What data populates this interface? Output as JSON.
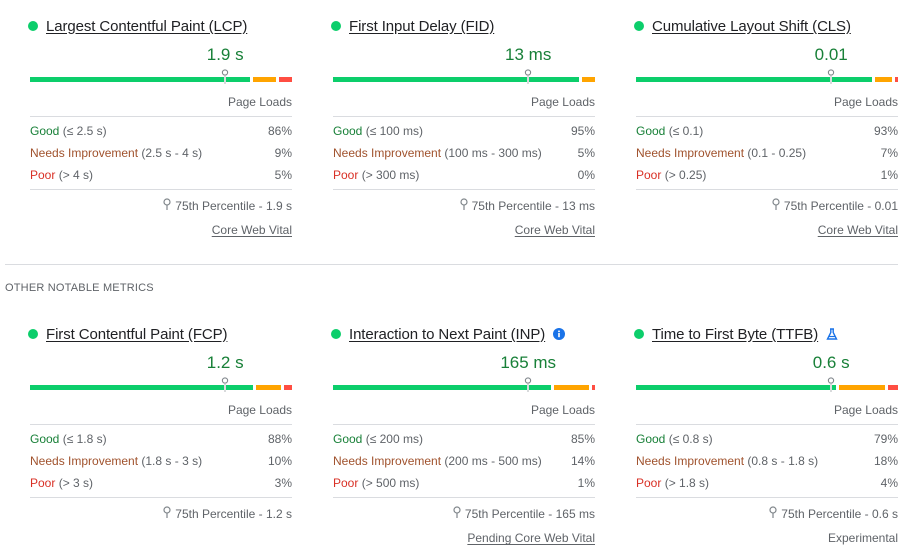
{
  "colors": {
    "good": "#0cce6b",
    "needs_improvement": "#ffa400",
    "poor": "#ff4e42",
    "value_text": "#188038",
    "info_icon": "#1a73e8"
  },
  "section_heading": "OTHER NOTABLE METRICS",
  "core_metrics": [
    {
      "title": "Largest Contentful Paint (LCP)",
      "value": "1.9 s",
      "marker_position": 0.745,
      "page_loads_label": "Page Loads",
      "distribution": [
        {
          "label": "Good",
          "range": "(≤ 2.5 s)",
          "percent": "86%",
          "fraction": 0.86
        },
        {
          "label": "Needs Improvement",
          "range": "(2.5 s - 4 s)",
          "percent": "9%",
          "fraction": 0.09
        },
        {
          "label": "Poor",
          "range": "(> 4 s)",
          "percent": "5%",
          "fraction": 0.05
        }
      ],
      "percentile_label": "75th Percentile - 1.9 s",
      "footer_label": "Core Web Vital",
      "footer_is_link": true,
      "extra_icon": null
    },
    {
      "title": "First Input Delay (FID)",
      "value": "13 ms",
      "marker_position": 0.745,
      "page_loads_label": "Page Loads",
      "distribution": [
        {
          "label": "Good",
          "range": "(≤ 100 ms)",
          "percent": "95%",
          "fraction": 0.95
        },
        {
          "label": "Needs Improvement",
          "range": "(100 ms - 300 ms)",
          "percent": "5%",
          "fraction": 0.05
        },
        {
          "label": "Poor",
          "range": "(> 300 ms)",
          "percent": "0%",
          "fraction": 0.0
        }
      ],
      "percentile_label": "75th Percentile - 13 ms",
      "footer_label": "Core Web Vital",
      "footer_is_link": true,
      "extra_icon": null
    },
    {
      "title": "Cumulative Layout Shift (CLS)",
      "value": "0.01",
      "marker_position": 0.745,
      "page_loads_label": "Page Loads",
      "distribution": [
        {
          "label": "Good",
          "range": "(≤ 0.1)",
          "percent": "93%",
          "fraction": 0.93
        },
        {
          "label": "Needs Improvement",
          "range": "(0.1 - 0.25)",
          "percent": "7%",
          "fraction": 0.07
        },
        {
          "label": "Poor",
          "range": "(> 0.25)",
          "percent": "1%",
          "fraction": 0.01
        }
      ],
      "percentile_label": "75th Percentile - 0.01",
      "footer_label": "Core Web Vital",
      "footer_is_link": true,
      "extra_icon": null
    }
  ],
  "other_metrics": [
    {
      "title": "First Contentful Paint (FCP)",
      "value": "1.2 s",
      "marker_position": 0.745,
      "page_loads_label": "Page Loads",
      "distribution": [
        {
          "label": "Good",
          "range": "(≤ 1.8 s)",
          "percent": "88%",
          "fraction": 0.88
        },
        {
          "label": "Needs Improvement",
          "range": "(1.8 s - 3 s)",
          "percent": "10%",
          "fraction": 0.1
        },
        {
          "label": "Poor",
          "range": "(> 3 s)",
          "percent": "3%",
          "fraction": 0.03
        }
      ],
      "percentile_label": "75th Percentile - 1.2 s",
      "footer_label": "",
      "footer_is_link": false,
      "extra_icon": null
    },
    {
      "title": "Interaction to Next Paint (INP)",
      "value": "165 ms",
      "marker_position": 0.745,
      "page_loads_label": "Page Loads",
      "distribution": [
        {
          "label": "Good",
          "range": "(≤ 200 ms)",
          "percent": "85%",
          "fraction": 0.85
        },
        {
          "label": "Needs Improvement",
          "range": "(200 ms - 500 ms)",
          "percent": "14%",
          "fraction": 0.14
        },
        {
          "label": "Poor",
          "range": "(> 500 ms)",
          "percent": "1%",
          "fraction": 0.01
        }
      ],
      "percentile_label": "75th Percentile - 165 ms",
      "footer_label": "Pending Core Web Vital",
      "footer_is_link": true,
      "extra_icon": "info-icon"
    },
    {
      "title": "Time to First Byte (TTFB)",
      "value": "0.6 s",
      "marker_position": 0.745,
      "page_loads_label": "Page Loads",
      "distribution": [
        {
          "label": "Good",
          "range": "(≤ 0.8 s)",
          "percent": "79%",
          "fraction": 0.79
        },
        {
          "label": "Needs Improvement",
          "range": "(0.8 s - 1.8 s)",
          "percent": "18%",
          "fraction": 0.18
        },
        {
          "label": "Poor",
          "range": "(> 1.8 s)",
          "percent": "4%",
          "fraction": 0.04
        }
      ],
      "percentile_label": "75th Percentile - 0.6 s",
      "footer_label": "Experimental",
      "footer_is_link": false,
      "extra_icon": "flask-icon"
    }
  ]
}
